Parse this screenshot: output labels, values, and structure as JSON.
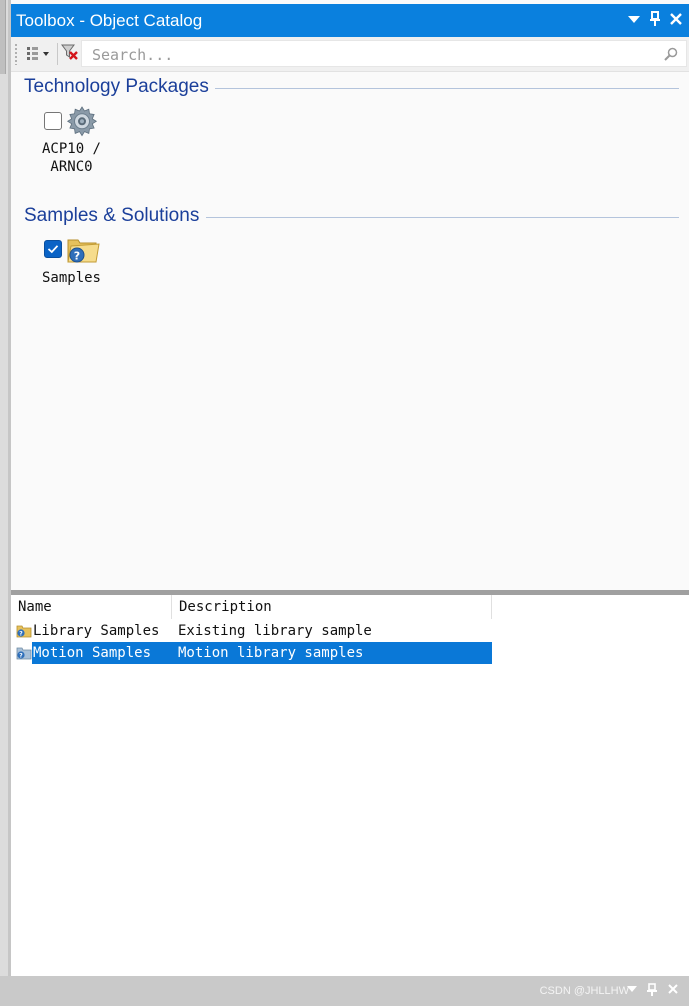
{
  "window": {
    "title": "Toolbox - Object Catalog"
  },
  "toolbar": {
    "view_options_icon": "view-options-icon",
    "clear_filter_icon": "clear-filter-icon",
    "search_placeholder": "Search...",
    "search_icon": "search-icon"
  },
  "groups": [
    {
      "title": "Technology Packages",
      "items": [
        {
          "label": "ACP10 /\nARNC0",
          "checked": false,
          "icon": "gear-icon"
        }
      ]
    },
    {
      "title": "Samples & Solutions",
      "items": [
        {
          "label": "Samples",
          "checked": true,
          "icon": "help-folder-icon"
        }
      ]
    }
  ],
  "list": {
    "columns": [
      "Name",
      "Description"
    ],
    "rows": [
      {
        "name": "Library Samples",
        "description": "Existing library sample",
        "selected": false
      },
      {
        "name": "Motion Samples",
        "description": "Motion library samples",
        "selected": true
      }
    ]
  },
  "footer": {
    "watermark": "CSDN @JHLLHW"
  },
  "colors": {
    "title_bar": "#0a80de",
    "group_title": "#1b3f9a",
    "selection": "#0a78d7",
    "checkbox_checked": "#0a63c6"
  }
}
